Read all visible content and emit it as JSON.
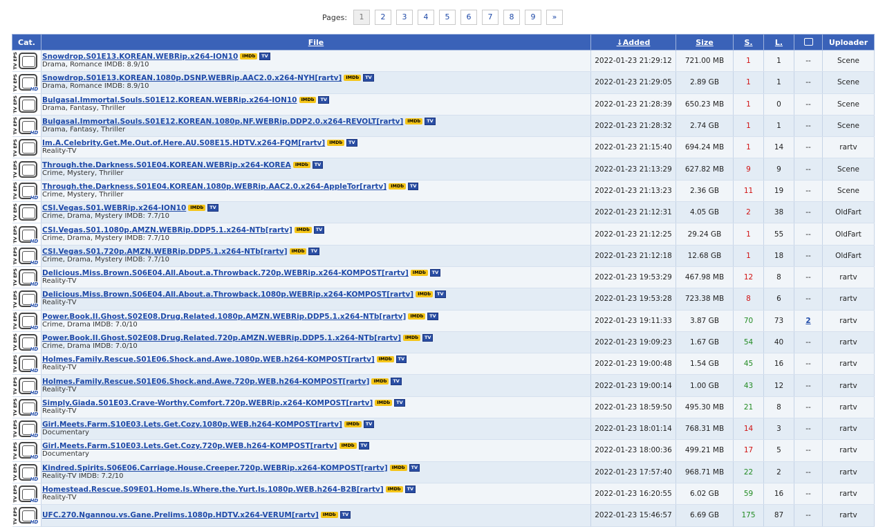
{
  "pager": {
    "label": "Pages:",
    "pages": [
      "1",
      "2",
      "3",
      "4",
      "5",
      "6",
      "7",
      "8",
      "9",
      "»"
    ],
    "current": "1"
  },
  "table": {
    "headers": {
      "cat": "Cat.",
      "file": "File",
      "added": "Added",
      "size": "Size",
      "seeders": "S.",
      "leechers": "L.",
      "comments_icon": "comments-icon",
      "uploader": "Uploader"
    },
    "category_icon_label": "TV EPS",
    "hd_label": "HD",
    "imdb_badge": "IMDb",
    "tv_badge": "TV",
    "rows": [
      {
        "hd": false,
        "title": "Snowdrop.S01E13.KOREAN.WEBRip.x264-ION10",
        "imdb": true,
        "genre": "Drama, Romance IMDB: 8.9/10",
        "added": "2022-01-23 21:29:12",
        "size": "721.00 MB",
        "s": "1",
        "s_color": "red",
        "l": "1",
        "c": "--",
        "uploader": "Scene"
      },
      {
        "hd": true,
        "title": "Snowdrop.S01E13.KOREAN.1080p.DSNP.WEBRip.AAC2.0.x264-NYH[rartv]",
        "imdb": true,
        "genre": "Drama, Romance IMDB: 8.9/10",
        "added": "2022-01-23 21:29:05",
        "size": "2.89 GB",
        "s": "1",
        "s_color": "red",
        "l": "1",
        "c": "--",
        "uploader": "Scene"
      },
      {
        "hd": false,
        "title": "Bulgasal.Immortal.Souls.S01E12.KOREAN.WEBRip.x264-ION10",
        "imdb": true,
        "genre": "Drama, Fantasy, Thriller",
        "added": "2022-01-23 21:28:39",
        "size": "650.23 MB",
        "s": "1",
        "s_color": "red",
        "l": "0",
        "c": "--",
        "uploader": "Scene"
      },
      {
        "hd": true,
        "title": "Bulgasal.Immortal.Souls.S01E12.KOREAN.1080p.NF.WEBRip.DDP2.0.x264-REVOLT[rartv]",
        "imdb": true,
        "genre": "Drama, Fantasy, Thriller",
        "added": "2022-01-23 21:28:32",
        "size": "2.74 GB",
        "s": "1",
        "s_color": "red",
        "l": "1",
        "c": "--",
        "uploader": "Scene"
      },
      {
        "hd": false,
        "title": "Im.A.Celebrity.Get.Me.Out.of.Here.AU.S08E15.HDTV.x264-FQM[rartv]",
        "imdb": true,
        "genre": "Reality-TV",
        "added": "2022-01-23 21:15:40",
        "size": "694.24 MB",
        "s": "1",
        "s_color": "red",
        "l": "14",
        "c": "--",
        "uploader": "rartv"
      },
      {
        "hd": false,
        "title": "Through.the.Darkness.S01E04.KOREAN.WEBRip.x264-KOREA",
        "imdb": true,
        "genre": "Crime, Mystery, Thriller",
        "added": "2022-01-23 21:13:29",
        "size": "627.82 MB",
        "s": "9",
        "s_color": "red",
        "l": "9",
        "c": "--",
        "uploader": "Scene"
      },
      {
        "hd": true,
        "title": "Through.the.Darkness.S01E04.KOREAN.1080p.WEBRip.AAC2.0.x264-AppleTor[rartv]",
        "imdb": true,
        "genre": "Crime, Mystery, Thriller",
        "added": "2022-01-23 21:13:23",
        "size": "2.36 GB",
        "s": "11",
        "s_color": "red",
        "l": "19",
        "c": "--",
        "uploader": "Scene"
      },
      {
        "hd": false,
        "title": "CSI.Vegas.S01.WEBRip.x264-ION10",
        "imdb": true,
        "genre": "Crime, Drama, Mystery IMDB: 7.7/10",
        "added": "2022-01-23 21:12:31",
        "size": "4.05 GB",
        "s": "2",
        "s_color": "red",
        "l": "38",
        "c": "--",
        "uploader": "OldFart"
      },
      {
        "hd": true,
        "title": "CSI.Vegas.S01.1080p.AMZN.WEBRip.DDP5.1.x264-NTb[rartv]",
        "imdb": true,
        "genre": "Crime, Drama, Mystery IMDB: 7.7/10",
        "added": "2022-01-23 21:12:25",
        "size": "29.24 GB",
        "s": "1",
        "s_color": "red",
        "l": "55",
        "c": "--",
        "uploader": "OldFart"
      },
      {
        "hd": true,
        "title": "CSI.Vegas.S01.720p.AMZN.WEBRip.DDP5.1.x264-NTb[rartv]",
        "imdb": true,
        "genre": "Crime, Drama, Mystery IMDB: 7.7/10",
        "added": "2022-01-23 21:12:18",
        "size": "12.68 GB",
        "s": "1",
        "s_color": "red",
        "l": "18",
        "c": "--",
        "uploader": "OldFart"
      },
      {
        "hd": true,
        "title": "Delicious.Miss.Brown.S06E04.All.About.a.Throwback.720p.WEBRip.x264-KOMPOST[rartv]",
        "imdb": true,
        "genre": "Reality-TV",
        "added": "2022-01-23 19:53:29",
        "size": "467.98 MB",
        "s": "12",
        "s_color": "red",
        "l": "8",
        "c": "--",
        "uploader": "rartv"
      },
      {
        "hd": true,
        "title": "Delicious.Miss.Brown.S06E04.All.About.a.Throwback.1080p.WEBRip.x264-KOMPOST[rartv]",
        "imdb": true,
        "genre": "Reality-TV",
        "added": "2022-01-23 19:53:28",
        "size": "723.38 MB",
        "s": "8",
        "s_color": "red",
        "l": "6",
        "c": "--",
        "uploader": "rartv"
      },
      {
        "hd": true,
        "title": "Power.Book.II.Ghost.S02E08.Drug.Related.1080p.AMZN.WEBRip.DDP5.1.x264-NTb[rartv]",
        "imdb": true,
        "genre": "Crime, Drama IMDB: 7.0/10",
        "added": "2022-01-23 19:11:33",
        "size": "3.87 GB",
        "s": "70",
        "s_color": "green",
        "l": "73",
        "c": "2",
        "uploader": "rartv"
      },
      {
        "hd": true,
        "title": "Power.Book.II.Ghost.S02E08.Drug.Related.720p.AMZN.WEBRip.DDP5.1.x264-NTb[rartv]",
        "imdb": true,
        "genre": "Crime, Drama IMDB: 7.0/10",
        "added": "2022-01-23 19:09:23",
        "size": "1.67 GB",
        "s": "54",
        "s_color": "green",
        "l": "40",
        "c": "--",
        "uploader": "rartv"
      },
      {
        "hd": true,
        "title": "Holmes.Family.Rescue.S01E06.Shock.and.Awe.1080p.WEB.h264-KOMPOST[rartv]",
        "imdb": true,
        "genre": "Reality-TV",
        "added": "2022-01-23 19:00:48",
        "size": "1.54 GB",
        "s": "45",
        "s_color": "green",
        "l": "16",
        "c": "--",
        "uploader": "rartv"
      },
      {
        "hd": true,
        "title": "Holmes.Family.Rescue.S01E06.Shock.and.Awe.720p.WEB.h264-KOMPOST[rartv]",
        "imdb": true,
        "genre": "Reality-TV",
        "added": "2022-01-23 19:00:14",
        "size": "1.00 GB",
        "s": "43",
        "s_color": "green",
        "l": "12",
        "c": "--",
        "uploader": "rartv"
      },
      {
        "hd": true,
        "title": "Simply.Giada.S01E03.Crave-Worthy.Comfort.720p.WEBRip.x264-KOMPOST[rartv]",
        "imdb": true,
        "genre": "Reality-TV",
        "added": "2022-01-23 18:59:50",
        "size": "495.30 MB",
        "s": "21",
        "s_color": "green",
        "l": "8",
        "c": "--",
        "uploader": "rartv"
      },
      {
        "hd": true,
        "title": "Girl.Meets.Farm.S10E03.Lets.Get.Cozy.1080p.WEB.h264-KOMPOST[rartv]",
        "imdb": true,
        "genre": "Documentary",
        "added": "2022-01-23 18:01:14",
        "size": "768.31 MB",
        "s": "14",
        "s_color": "red",
        "l": "3",
        "c": "--",
        "uploader": "rartv"
      },
      {
        "hd": true,
        "title": "Girl.Meets.Farm.S10E03.Lets.Get.Cozy.720p.WEB.h264-KOMPOST[rartv]",
        "imdb": true,
        "genre": "Documentary",
        "added": "2022-01-23 18:00:36",
        "size": "499.21 MB",
        "s": "17",
        "s_color": "red",
        "l": "5",
        "c": "--",
        "uploader": "rartv"
      },
      {
        "hd": true,
        "title": "Kindred.Spirits.S06E06.Carriage.House.Creeper.720p.WEBRip.x264-KOMPOST[rartv]",
        "imdb": true,
        "genre": "Reality-TV IMDB: 7.2/10",
        "added": "2022-01-23 17:57:40",
        "size": "968.71 MB",
        "s": "22",
        "s_color": "green",
        "l": "2",
        "c": "--",
        "uploader": "rartv"
      },
      {
        "hd": true,
        "title": "Homestead.Rescue.S09E01.Home.Is.Where.the.Yurt.Is.1080p.WEB.h264-B2B[rartv]",
        "imdb": true,
        "genre": "Reality-TV",
        "added": "2022-01-23 16:20:55",
        "size": "6.02 GB",
        "s": "59",
        "s_color": "green",
        "l": "16",
        "c": "--",
        "uploader": "rartv"
      },
      {
        "hd": true,
        "title": "UFC.270.Ngannou.vs.Gane.Prelims.1080p.HDTV.x264-VERUM[rartv]",
        "imdb": true,
        "genre": "",
        "added": "2022-01-23 15:46:57",
        "size": "6.69 GB",
        "s": "175",
        "s_color": "green",
        "l": "87",
        "c": "--",
        "uploader": "rartv"
      }
    ]
  }
}
